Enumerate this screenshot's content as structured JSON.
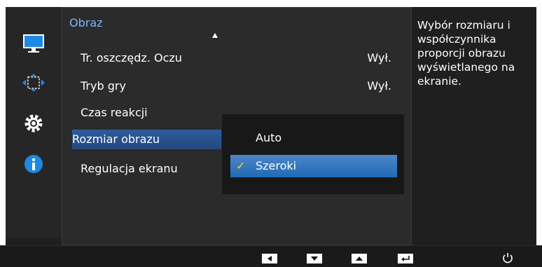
{
  "menu": {
    "title": "Obraz",
    "items": [
      {
        "label": "Tr. oszczędz. Oczu",
        "value": "Wył."
      },
      {
        "label": "Tryb gry",
        "value": "Wył."
      },
      {
        "label": "Czas reakcji",
        "value": ""
      },
      {
        "label": "Rozmiar obrazu",
        "value": ""
      },
      {
        "label": "Regulacja ekranu",
        "value": ""
      }
    ]
  },
  "submenu": {
    "options": [
      {
        "label": "Auto"
      },
      {
        "label": "Szeroki"
      }
    ]
  },
  "help": {
    "text": "Wybór rozmiaru i współczynnika proporcji obrazu wyświetlanego na ekranie."
  },
  "icons": [
    "monitor-icon",
    "picture-size-icon",
    "gear-icon",
    "info-icon"
  ],
  "colors": {
    "accent_blue": "#2e5c9c",
    "selection_blue": "#1f6bb6",
    "title_blue": "#7ab8ff",
    "check_yellow": "#ffd21e"
  }
}
